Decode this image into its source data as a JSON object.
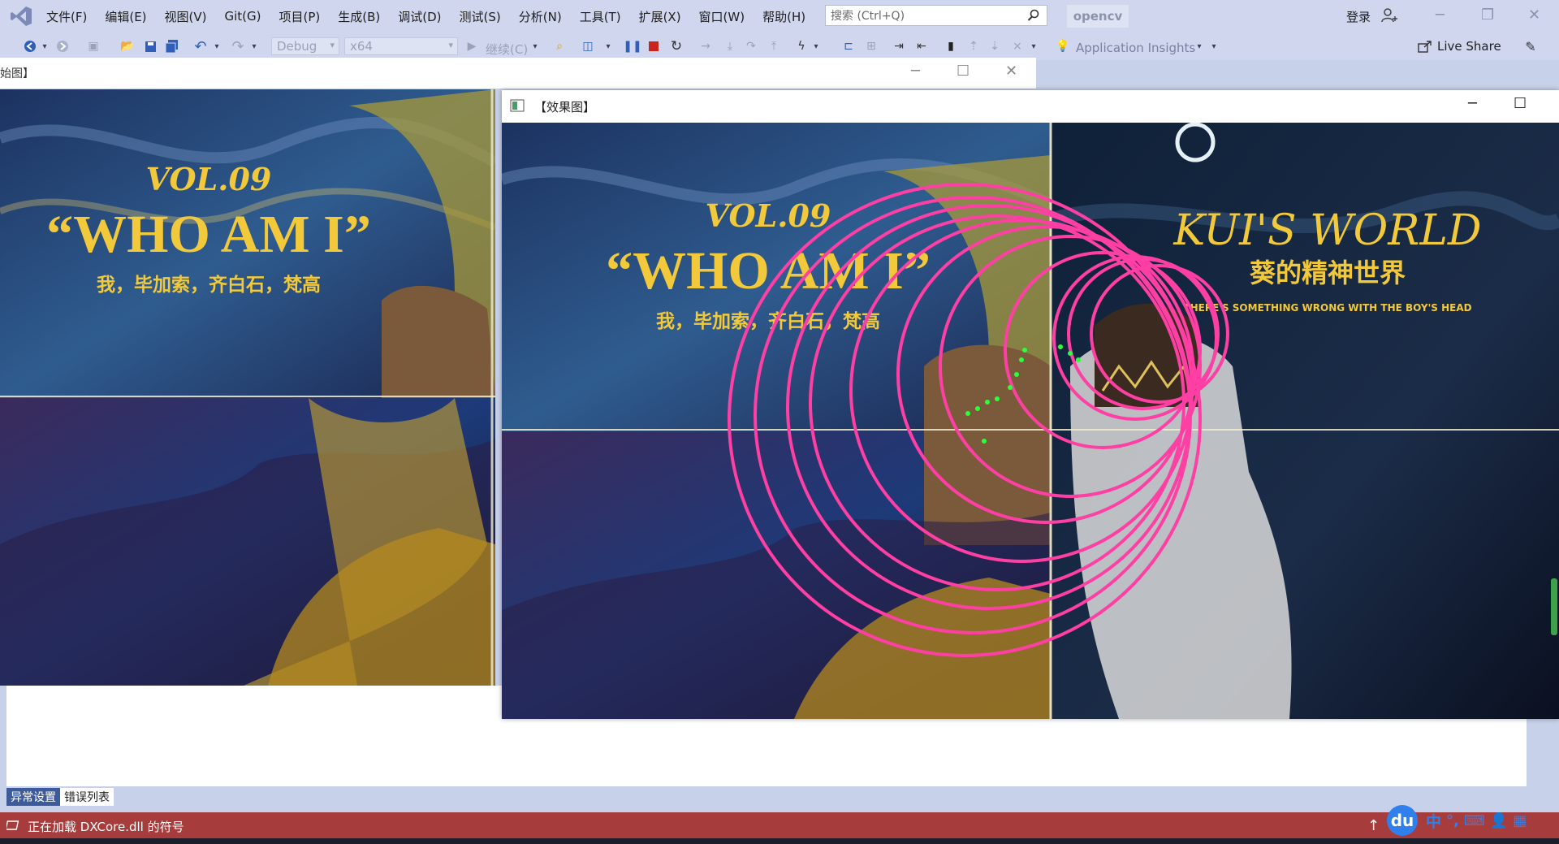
{
  "menubar": {
    "items": [
      "文件(F)",
      "编辑(E)",
      "视图(V)",
      "Git(G)",
      "项目(P)",
      "生成(B)",
      "调试(D)",
      "测试(S)",
      "分析(N)",
      "工具(T)",
      "扩展(X)",
      "窗口(W)",
      "帮助(H)"
    ],
    "search_placeholder": "搜索 (Ctrl+Q)",
    "solution_name": "opencv",
    "login_label": "登录"
  },
  "toolbar": {
    "config": "Debug",
    "platform": "x64",
    "continue_label": "继续(C)",
    "app_insights": "Application Insights",
    "live_share": "Live Share"
  },
  "window_original": {
    "title": "始图】",
    "poster": {
      "vol": "VOL.09",
      "headline": "“WHO AM I”",
      "subtitle": "我，毕加索，齐白石，梵高"
    }
  },
  "window_effect": {
    "title": "【效果图】",
    "poster": {
      "vol": "VOL.09",
      "headline": "“WHO AM I”",
      "subtitle": "我，毕加索，齐白石，梵高",
      "right_title": "KUI'S WORLD",
      "right_cn": "葵的精神世界",
      "right_tagline": "THERE'S SOMETHING WRONG WITH THE BOY'S HEAD"
    }
  },
  "bottom_tabs": [
    "异常设置",
    "错误列表"
  ],
  "status": {
    "text": "正在加载 DXCore.dll 的符号"
  },
  "tray": {
    "baidu": "du",
    "ime": "中"
  }
}
